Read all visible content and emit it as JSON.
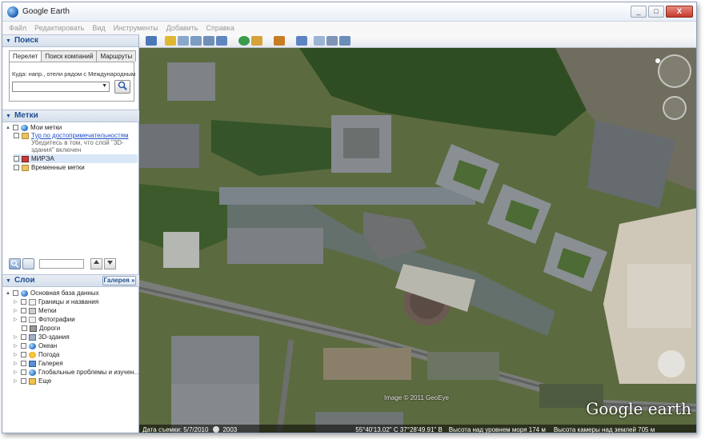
{
  "window": {
    "title": "Google Earth",
    "btn_min": "_",
    "btn_max": "□",
    "btn_close": "X"
  },
  "menu": [
    "Файл",
    "Редактировать",
    "Вид",
    "Инструменты",
    "Добавить",
    "Справка"
  ],
  "search": {
    "header": "Поиск",
    "tabs": [
      "Перелет",
      "Поиск компаний",
      "Маршруты"
    ],
    "label": "Куда: напр., отели рядом с Международным",
    "input_value": ""
  },
  "places": {
    "header": "Метки",
    "my_places": "Мои метки",
    "tour_link": "Тур по достопримечательностям",
    "tour_desc1": "Убедитесь в том, что слой \"3D-",
    "tour_desc2": "здания\" включен",
    "mirea": "МИРЭА",
    "temp": "Временные метки"
  },
  "layers": {
    "header": "Слои",
    "gallery_button": "Галерея",
    "gallery_chevrons": "»",
    "db": "Основная база данных",
    "items": [
      "Границы и названия",
      "Метки",
      "Фотографии",
      "Дороги",
      "3D-здания",
      "Океан",
      "Погода",
      "Галерея",
      "Глобальные проблемы и изучен…",
      "Еще"
    ]
  },
  "map": {
    "credit": "Image © 2011 GeoEye",
    "logo": "Google earth",
    "status": {
      "date": "Дата съемки: 5/7/2010",
      "year": "2003",
      "coords": "55°40'13.02\" С  37°28'49.91\" В",
      "elevation": "Высота над уровнем моря  174 м",
      "eye": "Высота камеры над землей  705 м"
    }
  },
  "colors": {
    "accent": "#1d4f91",
    "link": "#1f4fc8"
  }
}
